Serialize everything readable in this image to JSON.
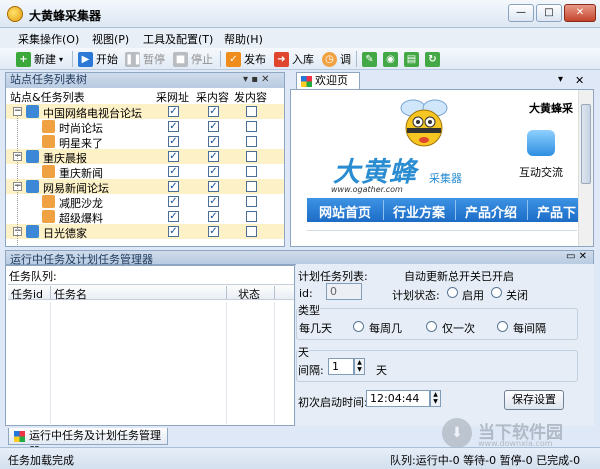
{
  "window": {
    "title": "大黄蜂采集器",
    "min": "—",
    "max": "□",
    "close": "✕"
  },
  "menu": [
    "采集操作(O)",
    "视图(P)",
    "工具及配置(T)",
    "帮助(H)"
  ],
  "toolbar": {
    "new": "新建",
    "start": "开始",
    "pause": "暂停",
    "stop": "停止",
    "publish": "发布",
    "import": "入库",
    "schedule": "调"
  },
  "tree_panel": {
    "title": "站点任务列表树",
    "pin": "▾ ▪ ✕",
    "headers": {
      "name": "站点&任务列表",
      "col1": "采网址",
      "col2": "采内容",
      "col3": "发内容"
    },
    "rows": [
      {
        "label": "中国网络电视台论坛",
        "type": "site",
        "c1": true,
        "c2": true,
        "c3": false
      },
      {
        "label": "时尚论坛",
        "type": "task",
        "c1": true,
        "c2": true,
        "c3": false
      },
      {
        "label": "明星来了",
        "type": "task",
        "c1": true,
        "c2": true,
        "c3": false
      },
      {
        "label": "重庆晨报",
        "type": "site",
        "c1": true,
        "c2": true,
        "c3": false
      },
      {
        "label": "重庆新闻",
        "type": "task",
        "c1": true,
        "c2": true,
        "c3": false
      },
      {
        "label": "网易新闻论坛",
        "type": "site",
        "c1": true,
        "c2": true,
        "c3": false
      },
      {
        "label": "减肥沙龙",
        "type": "task",
        "c1": true,
        "c2": true,
        "c3": false
      },
      {
        "label": "超级爆料",
        "type": "task",
        "c1": true,
        "c2": true,
        "c3": false
      },
      {
        "label": "日光德家",
        "type": "site",
        "c1": true,
        "c2": true,
        "c3": false
      }
    ]
  },
  "doc_tab": {
    "label": "欢迎页",
    "close": "✕",
    "arrow": "▾"
  },
  "browser": {
    "brand": "大黄蜂采",
    "logo": "大黄蜂",
    "logo_sub": "采集器",
    "url": "www.ogather.com",
    "community": "互动交流",
    "nav": [
      "网站首页",
      "行业方案",
      "产品介绍",
      "产品下"
    ]
  },
  "run_panel": {
    "title": "运行中任务及计划任务管理器",
    "pin": "▭ ✕",
    "queue_label": "任务队列:",
    "columns": [
      "任务id",
      "任务名",
      "状态"
    ]
  },
  "schedule": {
    "list_label": "计划任务列表:",
    "auto_update": "自动更新总开关已开启",
    "id_label": "id:",
    "id_value": "0",
    "status_label": "计划状态:",
    "enable": "启用",
    "disable": "关闭",
    "type_label": "类型",
    "types": [
      "每几天",
      "每周几",
      "仅一次",
      "每间隔"
    ],
    "days_label": "天",
    "interval_label": "间隔:",
    "interval_value": "1",
    "interval_unit": "天",
    "start_label": "初次启动时间:",
    "start_value": "12:04:44",
    "save": "保存设置"
  },
  "bottom_tab": {
    "label": "运行中任务及计划任务管理器"
  },
  "status": {
    "left": "任务加载完成",
    "right": "队列:运行中-0 等待-0 暂停-0 已完成-0"
  },
  "watermark": {
    "text": "当下软件园",
    "url": "www.downxia.com"
  },
  "colors": {
    "accent": "#1c6cc6",
    "highlight_row": "#fdf1c8",
    "panel_head": "#b8cbe1"
  }
}
